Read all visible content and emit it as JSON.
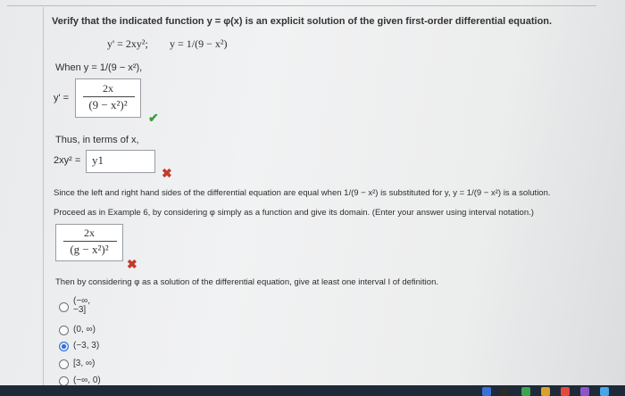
{
  "question": {
    "prompt": "Verify that the indicated function y = φ(x) is an explicit solution of the given first-order differential equation.",
    "equation": "y' = 2xy²;",
    "function": "y = 1/(9 − x²)"
  },
  "part1": {
    "when_text": "When y = 1/(9 − x²),",
    "yprime_label": "y' =",
    "answer_num": "2x",
    "answer_den": "(9 − x²)²",
    "status": "correct"
  },
  "part2": {
    "thus_text": "Thus, in terms of x,",
    "lhs_label": "2xy² =",
    "answer": "y1",
    "status": "incorrect"
  },
  "part3": {
    "since_text": "Since the left and right hand sides of the differential equation are equal when 1/(9 − x²) is substituted for y, y = 1/(9 − x²) is a solution.",
    "proceed_text": "Proceed as in Example 6, by considering φ simply as a function and give its domain. (Enter your answer using interval notation.)",
    "answer_num": "2x",
    "answer_den": "(g − x²)²",
    "status": "incorrect"
  },
  "part4": {
    "then_text": "Then by considering φ as a solution of the differential equation, give at least one interval I of definition.",
    "options": [
      {
        "label": "(−∞, −3]",
        "selected": false
      },
      {
        "label": "(0, ∞)",
        "selected": false
      },
      {
        "label": "(−3, 3)",
        "selected": true
      },
      {
        "label": "[3, ∞)",
        "selected": false
      },
      {
        "label": "(−∞, 0)",
        "selected": false
      }
    ],
    "option0_line1": "(−∞,",
    "option0_line2": "−3]"
  },
  "icons": {
    "correct": "check-icon",
    "incorrect": "cross-icon"
  },
  "colors": {
    "correct": "#3a9c3a",
    "incorrect": "#c23a2a",
    "radio_selected": "#2f6fd6"
  }
}
